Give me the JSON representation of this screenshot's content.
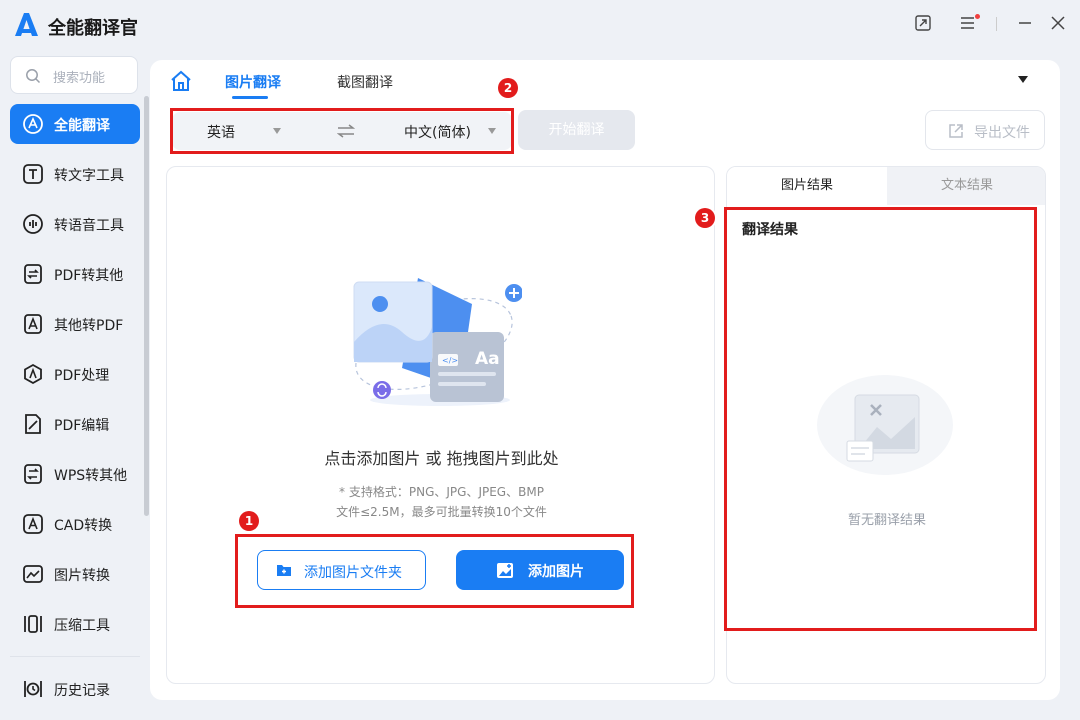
{
  "app": {
    "title": "全能翻译官"
  },
  "colors": {
    "accent": "#1a7df3",
    "annotation": "#e21c1c"
  },
  "sidebar": {
    "search_placeholder": "搜索功能",
    "items": [
      {
        "label": "全能翻译",
        "icon": "translate-icon",
        "active": true
      },
      {
        "label": "转文字工具",
        "icon": "text-icon"
      },
      {
        "label": "转语音工具",
        "icon": "audio-icon"
      },
      {
        "label": "PDF转其他",
        "icon": "pdf-convert-icon"
      },
      {
        "label": "其他转PDF",
        "icon": "to-pdf-icon"
      },
      {
        "label": "PDF处理",
        "icon": "pdf-process-icon"
      },
      {
        "label": "PDF编辑",
        "icon": "pdf-edit-icon"
      },
      {
        "label": "WPS转其他",
        "icon": "wps-icon"
      },
      {
        "label": "CAD转换",
        "icon": "cad-icon"
      },
      {
        "label": "图片转换",
        "icon": "image-icon"
      },
      {
        "label": "压缩工具",
        "icon": "compress-icon"
      },
      {
        "label": "历史记录",
        "icon": "history-icon"
      }
    ]
  },
  "main": {
    "tabs": [
      {
        "label": "图片翻译",
        "active": true
      },
      {
        "label": "截图翻译"
      }
    ],
    "source_lang": "英语",
    "target_lang": "中文(简体)",
    "start_label": "开始翻译",
    "export_label": "导出文件"
  },
  "upload": {
    "hint": "点击添加图片 或 拖拽图片到此处",
    "formats": "* 支持格式：PNG、JPG、JPEG、BMP",
    "limits": "文件≤2.5M，最多可批量转换10个文件",
    "add_folder_label": "添加图片文件夹",
    "add_image_label": "添加图片",
    "illustration_text": "Aa"
  },
  "result": {
    "tabs": [
      {
        "label": "图片结果",
        "active": true
      },
      {
        "label": "文本结果"
      }
    ],
    "title": "翻译结果",
    "empty": "暂无翻译结果"
  },
  "annotations": [
    "1",
    "2",
    "3"
  ]
}
